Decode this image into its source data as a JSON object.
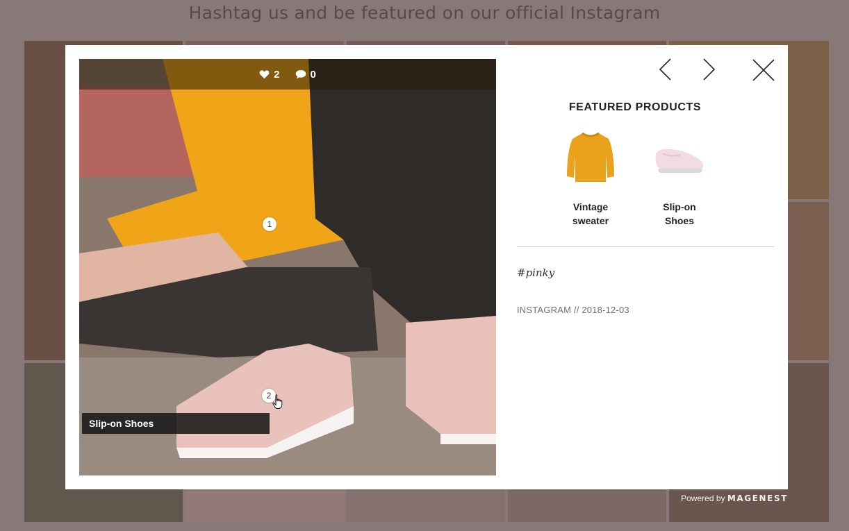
{
  "heading": "Hashtag us and be featured on our official Instagram",
  "post": {
    "likes": "2",
    "comments": "0",
    "hotspots": [
      {
        "label": "1"
      },
      {
        "label": "2"
      }
    ],
    "tooltip": "Slip-on Shoes"
  },
  "featured": {
    "title": "FEATURED PRODUCTS",
    "products": [
      {
        "name_line1": "Vintage",
        "name_line2": "sweater",
        "icon": "sweater-icon",
        "color": "#e8a21b"
      },
      {
        "name_line1": "Slip-on",
        "name_line2": "Shoes",
        "icon": "shoe-icon",
        "color": "#f3dbe5"
      }
    ]
  },
  "caption": "#pinky",
  "source": "INSTAGRAM // 2018-12-03",
  "footer": {
    "powered_text": "Powered by",
    "brand": "MAGENEST"
  },
  "colors": {
    "accent_yellow": "#e8a21b",
    "modal_bg": "#ffffff",
    "backdrop": "#a29595"
  }
}
